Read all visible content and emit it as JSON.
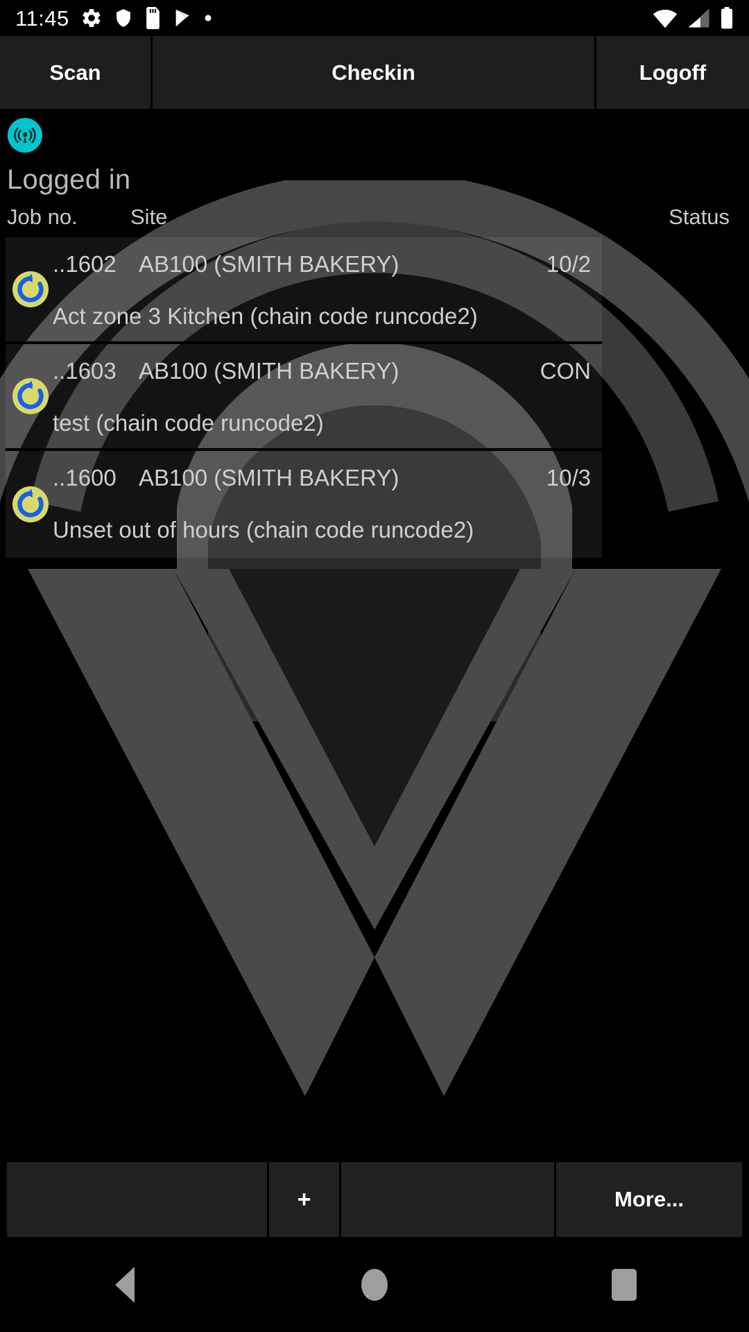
{
  "status_bar": {
    "time": "11:45",
    "left_icons": [
      "gear-icon",
      "shield-icon",
      "sd-card-icon",
      "play-store-icon",
      "dot-icon"
    ],
    "right_icons": [
      "wifi-icon",
      "cellular-signal-icon",
      "battery-icon"
    ]
  },
  "tabs": [
    {
      "label": "Scan",
      "name": "tab-scan"
    },
    {
      "label": "Checkin",
      "name": "tab-checkin"
    },
    {
      "label": "Logoff",
      "name": "tab-logoff"
    }
  ],
  "app": {
    "brand_icon": "broadcast-signal-icon",
    "brand_icon_color": "#00c5cf",
    "login_status": "Logged in"
  },
  "columns": {
    "job_no": "Job no.",
    "site": "Site",
    "status": "Status"
  },
  "jobs": [
    {
      "job_no": "..1602",
      "site": "AB100 (SMITH BAKERY)",
      "status": "10/2",
      "description": "Act zone 3 Kitchen (chain code runcode2)",
      "icon": "refresh-sync-icon"
    },
    {
      "job_no": "..1603",
      "site": "AB100 (SMITH BAKERY)",
      "status": "CON",
      "description": "test (chain code runcode2)",
      "icon": "refresh-sync-icon"
    },
    {
      "job_no": "..1600",
      "site": "AB100 (SMITH BAKERY)",
      "status": "10/3",
      "description": "Unset out of hours (chain code runcode2)",
      "icon": "refresh-sync-icon"
    }
  ],
  "bottom_buttons": [
    {
      "label": "",
      "name": "bottom-button-1"
    },
    {
      "label": "+",
      "name": "add-button"
    },
    {
      "label": "",
      "name": "bottom-button-3"
    },
    {
      "label": "More...",
      "name": "more-button"
    }
  ],
  "nav_bar": {
    "back": "back-triangle-icon",
    "home": "home-circle-icon",
    "recents": "recents-square-icon"
  },
  "colors": {
    "accent_teal": "#00c5cf",
    "row_icon_bg": "#d9d96a",
    "row_icon_arrow": "#1a5fe8",
    "tab_bg": "#1e1e1e",
    "screen_bg": "#000000",
    "watermark": "#4a4a4a"
  }
}
